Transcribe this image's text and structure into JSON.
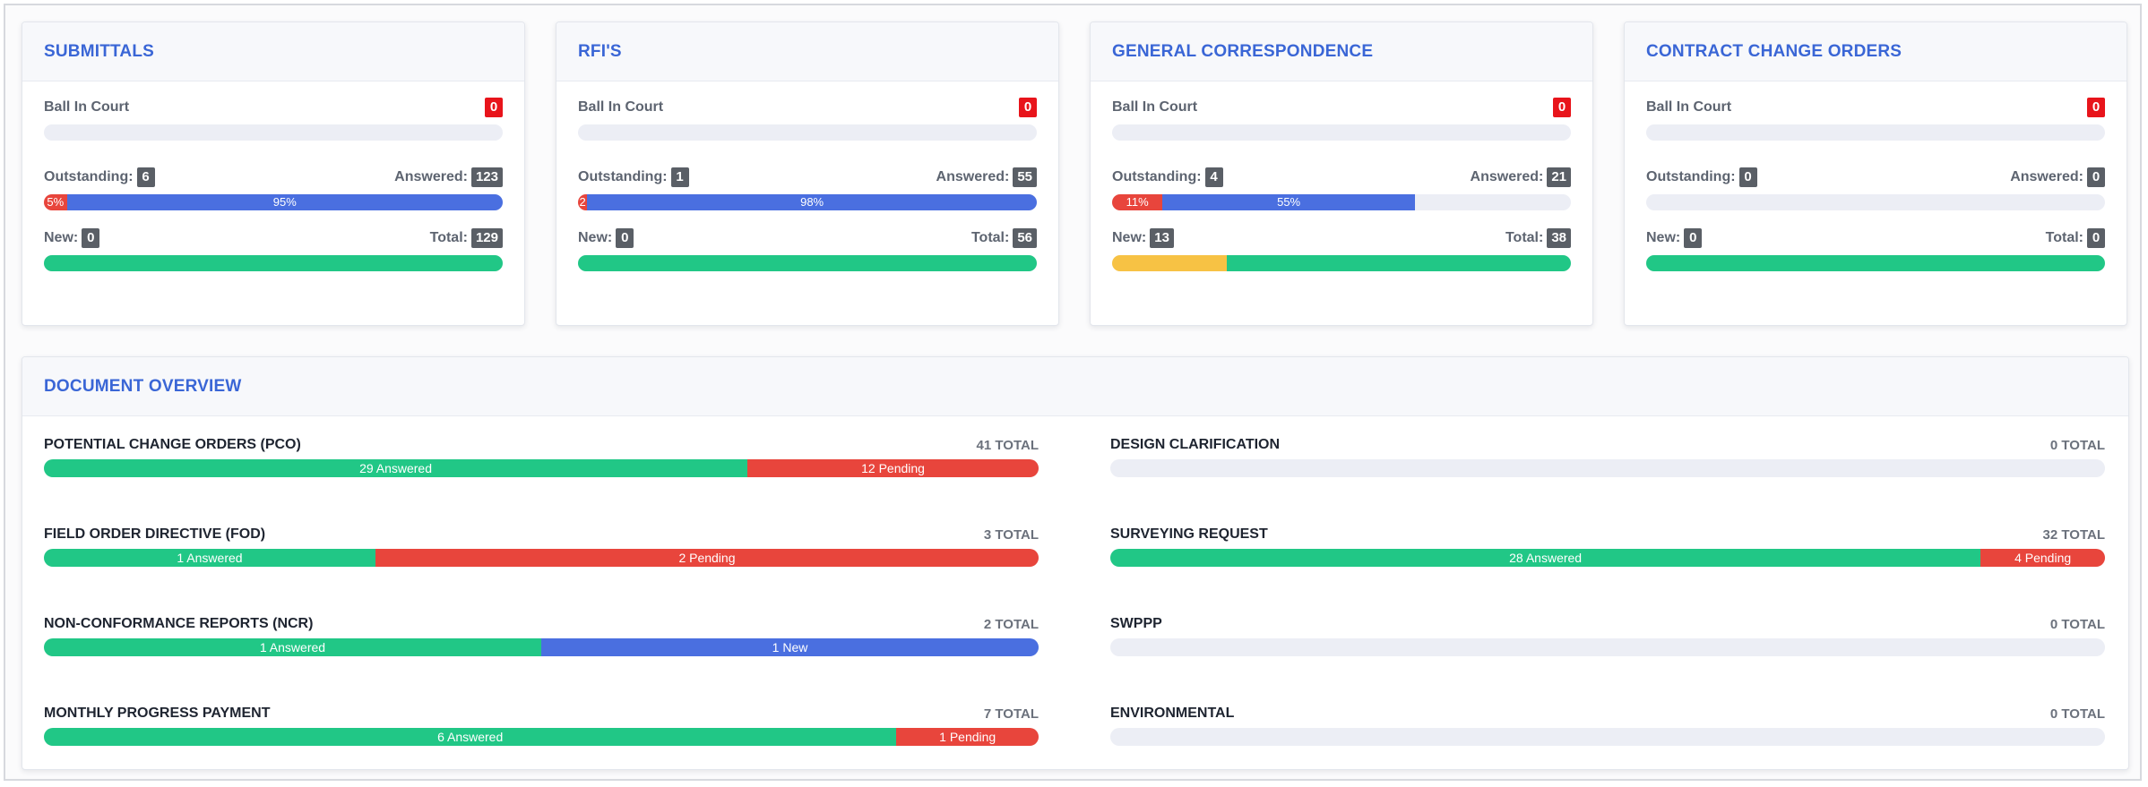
{
  "cards": [
    {
      "title": "SUBMITTALS",
      "ball_label": "Ball In Court",
      "ball_value": "0",
      "outstanding_label": "Outstanding:",
      "outstanding_value": "6",
      "answered_label": "Answered:",
      "answered_value": "123",
      "new_label": "New:",
      "new_value": "0",
      "total_label": "Total:",
      "total_value": "129",
      "progress": [
        {
          "color": "red",
          "fraction": 0.05,
          "label": "5%"
        },
        {
          "color": "blue",
          "fraction": 0.95,
          "label": "95%"
        }
      ],
      "new_bar": [
        {
          "color": "green",
          "fraction": 1.0
        }
      ]
    },
    {
      "title": "RFI'S",
      "ball_label": "Ball In Court",
      "ball_value": "0",
      "outstanding_label": "Outstanding:",
      "outstanding_value": "1",
      "answered_label": "Answered:",
      "answered_value": "55",
      "new_label": "New:",
      "new_value": "0",
      "total_label": "Total:",
      "total_value": "56",
      "progress": [
        {
          "color": "red",
          "fraction": 0.02,
          "label": "2"
        },
        {
          "color": "blue",
          "fraction": 0.98,
          "label": "98%"
        }
      ],
      "new_bar": [
        {
          "color": "green",
          "fraction": 1.0
        }
      ]
    },
    {
      "title": "GENERAL CORRESPONDENCE",
      "ball_label": "Ball In Court",
      "ball_value": "0",
      "outstanding_label": "Outstanding:",
      "outstanding_value": "4",
      "answered_label": "Answered:",
      "answered_value": "21",
      "new_label": "New:",
      "new_value": "13",
      "total_label": "Total:",
      "total_value": "38",
      "progress": [
        {
          "color": "red",
          "fraction": 0.11,
          "label": "11%"
        },
        {
          "color": "blue",
          "fraction": 0.55,
          "label": "55%"
        }
      ],
      "new_bar": [
        {
          "color": "yellow",
          "fraction": 0.25
        },
        {
          "color": "green",
          "fraction": 0.75
        }
      ]
    },
    {
      "title": "CONTRACT CHANGE ORDERS",
      "ball_label": "Ball In Court",
      "ball_value": "0",
      "outstanding_label": "Outstanding:",
      "outstanding_value": "0",
      "answered_label": "Answered:",
      "answered_value": "0",
      "new_label": "New:",
      "new_value": "0",
      "total_label": "Total:",
      "total_value": "0",
      "progress": [],
      "new_bar": [
        {
          "color": "green",
          "fraction": 1.0
        }
      ]
    }
  ],
  "overview": {
    "title": "DOCUMENT OVERVIEW",
    "items": [
      {
        "name": "POTENTIAL CHANGE ORDERS (PCO)",
        "total": "41 TOTAL",
        "segments": [
          {
            "color": "green",
            "fraction": 0.7073,
            "label": "29 Answered"
          },
          {
            "color": "red",
            "fraction": 0.2927,
            "label": "12 Pending"
          }
        ]
      },
      {
        "name": "FIELD ORDER DIRECTIVE (FOD)",
        "total": "3 TOTAL",
        "segments": [
          {
            "color": "green",
            "fraction": 0.3333,
            "label": "1 Answered"
          },
          {
            "color": "red",
            "fraction": 0.6667,
            "label": "2 Pending"
          }
        ]
      },
      {
        "name": "NON-CONFORMANCE REPORTS (NCR)",
        "total": "2 TOTAL",
        "segments": [
          {
            "color": "green",
            "fraction": 0.5,
            "label": "1 Answered"
          },
          {
            "color": "blue",
            "fraction": 0.5,
            "label": "1 New"
          }
        ]
      },
      {
        "name": "MONTHLY PROGRESS PAYMENT",
        "total": "7 TOTAL",
        "segments": [
          {
            "color": "green",
            "fraction": 0.8571,
            "label": "6 Answered"
          },
          {
            "color": "red",
            "fraction": 0.1429,
            "label": "1 Pending"
          }
        ]
      },
      {
        "name": "DESIGN CLARIFICATION",
        "total": "0 TOTAL",
        "segments": []
      },
      {
        "name": "SURVEYING REQUEST",
        "total": "32 TOTAL",
        "segments": [
          {
            "color": "green",
            "fraction": 0.875,
            "label": "28 Answered"
          },
          {
            "color": "red",
            "fraction": 0.125,
            "label": "4 Pending"
          }
        ]
      },
      {
        "name": "SWPPP",
        "total": "0 TOTAL",
        "segments": []
      },
      {
        "name": "ENVIRONMENTAL",
        "total": "0 TOTAL",
        "segments": []
      }
    ]
  }
}
